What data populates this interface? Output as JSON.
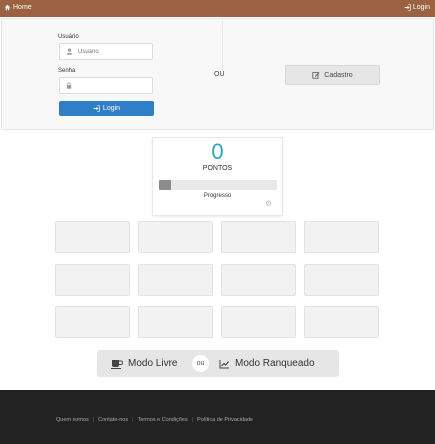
{
  "topbar": {
    "home_label": "Home",
    "login_label": "Login",
    "color": "#9b6241"
  },
  "login_form": {
    "user_label": "Usuário",
    "user_placeholder": "Usuário",
    "password_label": "Senha",
    "password_value": "",
    "login_button": "Login",
    "or_text": "OU",
    "register_button": "Cadastro",
    "login_button_color": "#2f7ec8"
  },
  "score": {
    "points": "0",
    "points_label": "PONTOS",
    "progress_label": "Progresso",
    "progress_fraction": 0.1,
    "accent": "#2ba6c4"
  },
  "modes": {
    "free_label": "Modo Livre",
    "or_text": "ou",
    "ranked_label": "Modo Ranqueado"
  },
  "footer": {
    "links": [
      "Quem somos",
      "Contate-nos",
      "Termos e Condições",
      "Política de Privacidade"
    ]
  }
}
